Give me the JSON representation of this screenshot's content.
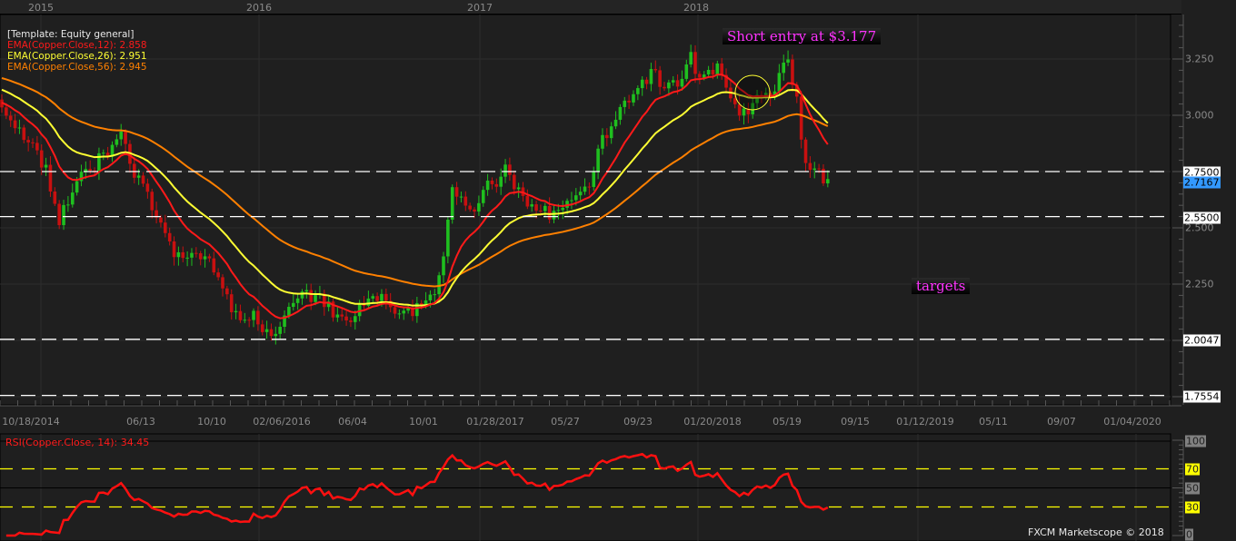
{
  "chart_data": {
    "type": "candlestick",
    "instrument": "Copper",
    "timeframe": "weekly",
    "top_years": [
      "2015",
      "2016",
      "2017",
      "2018"
    ],
    "legend": {
      "template": "[Template: Equity general]",
      "ema12": "EMA(Copper.Close,12): 2.858",
      "ema26": "EMA(Copper.Close,26): 2.951",
      "ema56": "EMA(Copper.Close,56): 2.945"
    },
    "colors": {
      "ema12": "#ff1a1a",
      "ema26": "#ffff33",
      "ema56": "#ff8000",
      "up": "#1fbf1f",
      "down": "#c81010",
      "rsi": "#ff1010"
    },
    "ylim": [
      1.72,
      3.45
    ],
    "y_ticks": [
      "3.250",
      "3.000",
      "2.500",
      "2.250"
    ],
    "y_tick_values": [
      3.25,
      3.0,
      2.5,
      2.25
    ],
    "levels": [
      {
        "value": 2.75,
        "label": "2.7500"
      },
      {
        "value": 2.55,
        "label": "2.5500"
      },
      {
        "value": 2.0047,
        "label": "2.0047"
      },
      {
        "value": 1.7554,
        "label": "1.7554"
      }
    ],
    "current_price": {
      "value": 2.7167,
      "label": "2.7167"
    },
    "x_labels": [
      "10/18/2014",
      "06/13",
      "10/10",
      "02/06/2016",
      "06/04",
      "10/01",
      "01/28/2017",
      "05/27",
      "09/23",
      "01/20/2018",
      "05/19",
      "09/15",
      "01/12/2019",
      "05/11",
      "09/07",
      "01/04/2020"
    ],
    "close_waypoints": [
      [
        0,
        3.05
      ],
      [
        4,
        2.95
      ],
      [
        10,
        2.75
      ],
      [
        13,
        2.52
      ],
      [
        16,
        2.68
      ],
      [
        20,
        2.75
      ],
      [
        24,
        2.85
      ],
      [
        27,
        2.92
      ],
      [
        30,
        2.75
      ],
      [
        34,
        2.6
      ],
      [
        37,
        2.45
      ],
      [
        41,
        2.35
      ],
      [
        45,
        2.38
      ],
      [
        49,
        2.3
      ],
      [
        53,
        2.1
      ],
      [
        57,
        2.12
      ],
      [
        61,
        1.99
      ],
      [
        65,
        2.18
      ],
      [
        70,
        2.2
      ],
      [
        74,
        2.15
      ],
      [
        78,
        2.08
      ],
      [
        82,
        2.15
      ],
      [
        86,
        2.2
      ],
      [
        90,
        2.12
      ],
      [
        94,
        2.14
      ],
      [
        98,
        2.2
      ],
      [
        100,
        2.4
      ],
      [
        102,
        2.65
      ],
      [
        107,
        2.6
      ],
      [
        111,
        2.7
      ],
      [
        114,
        2.75
      ],
      [
        117,
        2.65
      ],
      [
        121,
        2.6
      ],
      [
        125,
        2.55
      ],
      [
        129,
        2.62
      ],
      [
        133,
        2.7
      ],
      [
        136,
        2.9
      ],
      [
        139,
        3.0
      ],
      [
        144,
        3.1
      ],
      [
        147,
        3.2
      ],
      [
        150,
        3.1
      ],
      [
        153,
        3.15
      ],
      [
        156,
        3.25
      ],
      [
        159,
        3.15
      ],
      [
        162,
        3.2
      ],
      [
        165,
        3.05
      ],
      [
        168,
        3.0
      ],
      [
        171,
        3.1
      ],
      [
        174,
        3.08
      ],
      [
        178,
        3.25
      ],
      [
        180,
        3.05
      ],
      [
        182,
        2.8
      ],
      [
        184,
        2.75
      ],
      [
        186,
        2.73
      ],
      [
        187,
        2.72
      ]
    ],
    "ema_seed": {
      "ema12": 3.06,
      "ema26": 3.12,
      "ema56": 3.17
    },
    "annotations": {
      "short_entry": "Short entry at $3.177",
      "targets": "targets"
    },
    "rsi": {
      "label": "RSI(Copper.Close, 14): 34.45",
      "ticks": [
        "100",
        "70",
        "50",
        "30",
        "0"
      ],
      "tick_values": [
        100,
        70,
        50,
        30,
        0
      ],
      "overbought": 70,
      "oversold": 30
    }
  },
  "footer": "FXCM Marketscope © 2018"
}
